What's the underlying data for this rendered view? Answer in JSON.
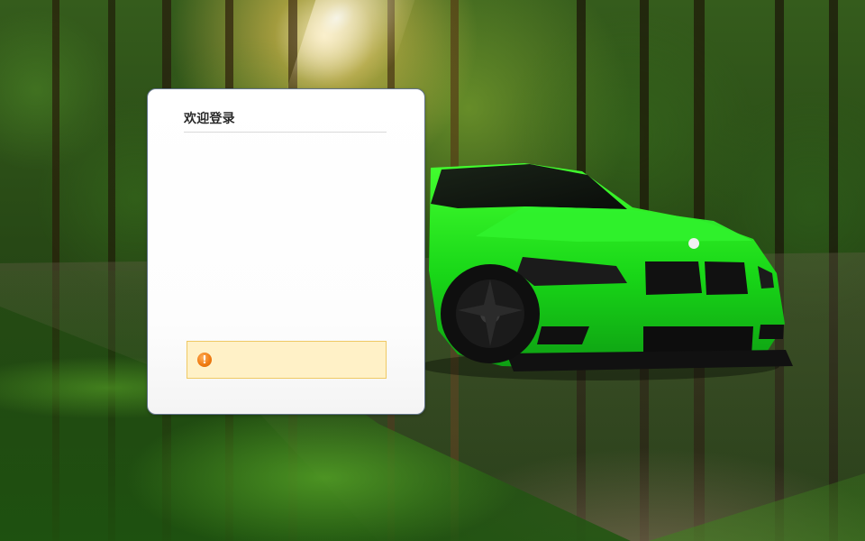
{
  "dialog": {
    "title": "欢迎登录",
    "alert_message": ""
  },
  "icons": {
    "alert": "warning-icon"
  },
  "colors": {
    "dialog_border": "#62738a",
    "alert_background": "#fff1c7",
    "alert_border": "#efc964",
    "alert_icon": "#f07c13"
  }
}
